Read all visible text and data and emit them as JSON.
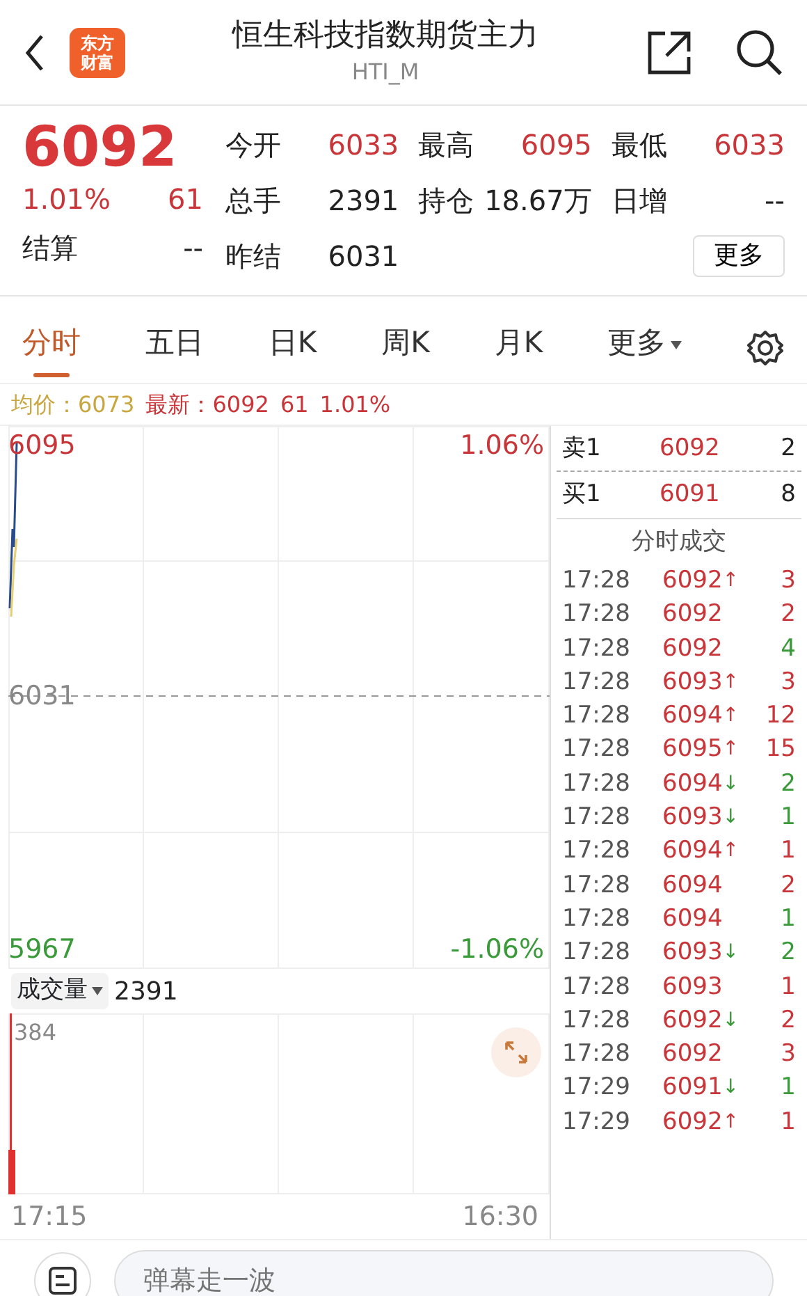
{
  "header": {
    "logo": [
      "东方",
      "财富"
    ],
    "title": "恒生科技指数期货主力",
    "code": "HTI_M"
  },
  "quote": {
    "price": "6092",
    "change_pct": "1.01%",
    "change": "61",
    "settle_label": "结算",
    "settle_value": "--",
    "stats": [
      {
        "label": "今开",
        "value": "6033",
        "rising": true
      },
      {
        "label": "最高",
        "value": "6095",
        "rising": true
      },
      {
        "label": "最低",
        "value": "6033",
        "rising": true
      },
      {
        "label": "总手",
        "value": "2391",
        "rising": false
      },
      {
        "label": "持仓",
        "value": "18.67万",
        "rising": false
      },
      {
        "label": "日增",
        "value": "--",
        "rising": false
      },
      {
        "label": "昨结",
        "value": "6031",
        "rising": false
      }
    ],
    "more_button": "更多"
  },
  "tabs": [
    {
      "label": "分时",
      "selected": true
    },
    {
      "label": "五日",
      "selected": false
    },
    {
      "label": "日K",
      "selected": false
    },
    {
      "label": "周K",
      "selected": false
    },
    {
      "label": "月K",
      "selected": false
    },
    {
      "label": "更多",
      "selected": false,
      "dropdown": true
    }
  ],
  "summary": {
    "avg_label": "均价：",
    "avg_value": "6073",
    "last_label": "最新：",
    "last_value": "6092",
    "change": "61",
    "change_pct": "1.01%"
  },
  "price_chart": {
    "top_price": "6095",
    "top_pct": "1.06%",
    "mid_price": "6031",
    "bottom_price": "5967",
    "bottom_pct": "-1.06%"
  },
  "volume_chart": {
    "selector": "成交量",
    "total": "2391",
    "max_label": "384",
    "start_time": "17:15",
    "end_time": "16:30"
  },
  "order_book": [
    {
      "label": "卖1",
      "price": "6092",
      "volume": "2"
    },
    {
      "label": "买1",
      "price": "6091",
      "volume": "8"
    }
  ],
  "trades_title": "分时成交",
  "trades": [
    {
      "time": "17:28",
      "price": "6092",
      "arrow": "↑",
      "rising": true,
      "volume": "3",
      "buy": true
    },
    {
      "time": "17:28",
      "price": "6092",
      "volume": "2",
      "buy": true
    },
    {
      "time": "17:28",
      "price": "6092",
      "volume": "4",
      "buy": false
    },
    {
      "time": "17:28",
      "price": "6093",
      "arrow": "↑",
      "rising": true,
      "volume": "3",
      "buy": true
    },
    {
      "time": "17:28",
      "price": "6094",
      "arrow": "↑",
      "rising": true,
      "volume": "12",
      "buy": true
    },
    {
      "time": "17:28",
      "price": "6095",
      "arrow": "↑",
      "rising": true,
      "volume": "15",
      "buy": true
    },
    {
      "time": "17:28",
      "price": "6094",
      "arrow": "↓",
      "rising": false,
      "volume": "2",
      "buy": false
    },
    {
      "time": "17:28",
      "price": "6093",
      "arrow": "↓",
      "rising": false,
      "volume": "1",
      "buy": false
    },
    {
      "time": "17:28",
      "price": "6094",
      "arrow": "↑",
      "rising": true,
      "volume": "1",
      "buy": true
    },
    {
      "time": "17:28",
      "price": "6094",
      "volume": "2",
      "buy": true
    },
    {
      "time": "17:28",
      "price": "6094",
      "volume": "1",
      "buy": false
    },
    {
      "time": "17:28",
      "price": "6093",
      "arrow": "↓",
      "rising": false,
      "volume": "2",
      "buy": false
    },
    {
      "time": "17:28",
      "price": "6093",
      "volume": "1",
      "buy": true
    },
    {
      "time": "17:28",
      "price": "6092",
      "arrow": "↓",
      "rising": false,
      "volume": "2",
      "buy": true
    },
    {
      "time": "17:28",
      "price": "6092",
      "volume": "3",
      "buy": true
    },
    {
      "time": "17:29",
      "price": "6091",
      "arrow": "↓",
      "rising": false,
      "volume": "1",
      "buy": false
    },
    {
      "time": "17:29",
      "price": "6092",
      "arrow": "↑",
      "rising": true,
      "volume": "1",
      "buy": true
    }
  ],
  "comment_bar": {
    "placeholder": "弹幕走一波"
  }
}
